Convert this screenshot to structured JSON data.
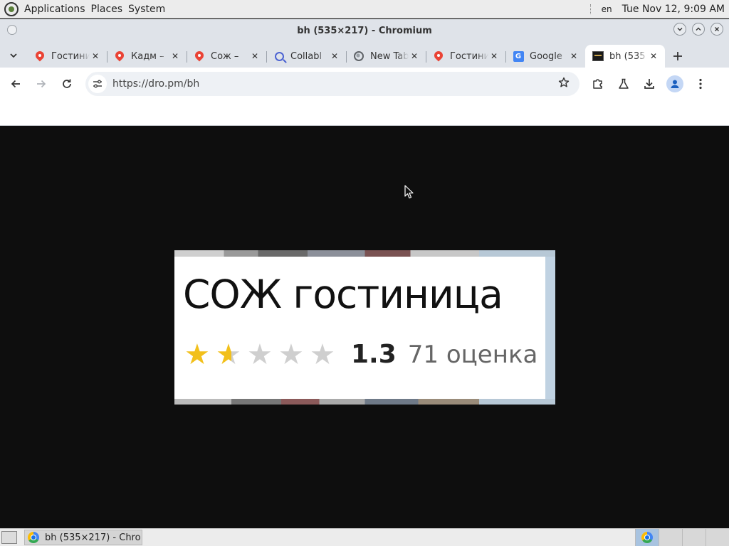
{
  "top_panel": {
    "menus": [
      "Applications",
      "Places",
      "System"
    ],
    "language": "en",
    "clock": "Tue Nov 12,  9:09 AM"
  },
  "window": {
    "title": "bh (535×217) - Chromium"
  },
  "tabs": [
    {
      "title": "Гостиница",
      "icon": "map-pin-icon"
    },
    {
      "title": "Кадм –",
      "icon": "map-pin-icon"
    },
    {
      "title": "Сож –",
      "icon": "map-pin-icon"
    },
    {
      "title": "Collabl",
      "icon": "magnifier-icon"
    },
    {
      "title": "New Tab",
      "icon": "globe-icon"
    },
    {
      "title": "Гостиница",
      "icon": "map-pin-icon"
    },
    {
      "title": "Google",
      "icon": "google-translate-icon"
    },
    {
      "title": "bh (535",
      "icon": "image-thumbnail-icon",
      "active": true
    }
  ],
  "toolbar": {
    "url": "https://dro.pm/bh"
  },
  "page_image": {
    "hotel_name": "СОЖ гостиница",
    "rating_value": "1.3",
    "rating_count": "71 оценка",
    "stars_filled": 1.5,
    "stars_total": 5
  },
  "taskbar": {
    "items": [
      {
        "label": "bh (535×217) - Chro…",
        "icon": "chromium-icon"
      }
    ]
  },
  "colors": {
    "star_filled": "#f2c01b",
    "star_empty": "#cfcfcf",
    "page_background": "#0e0e0e"
  }
}
